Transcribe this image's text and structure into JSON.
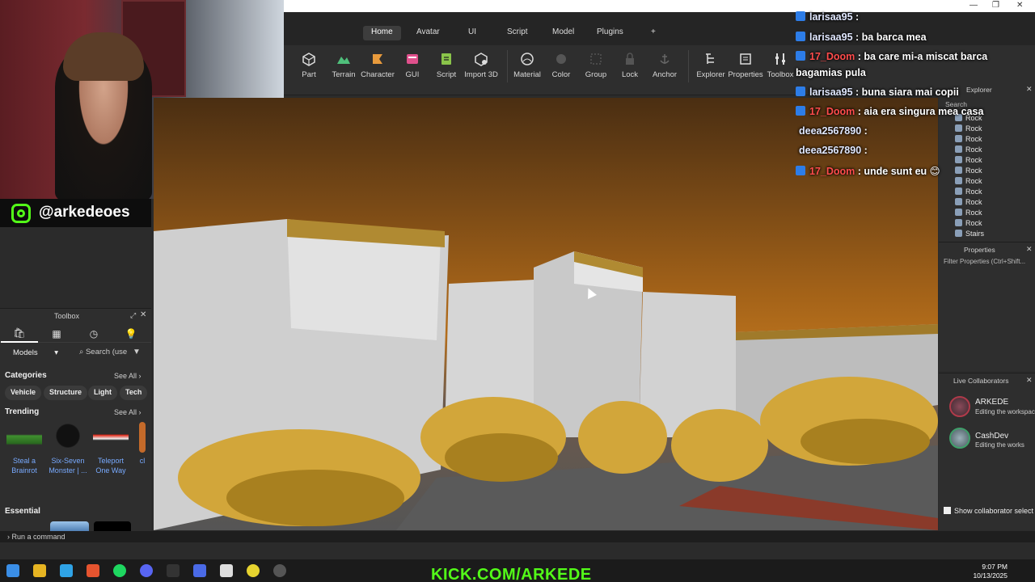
{
  "window": {
    "min": "—",
    "restore": "❐",
    "close": "✕"
  },
  "menu": {
    "tabs": [
      "Home",
      "Avatar",
      "UI",
      "Script",
      "Model",
      "Plugins"
    ],
    "add": "+"
  },
  "ribbon": {
    "tools": [
      "Part",
      "Terrain",
      "Character",
      "GUI",
      "Script",
      "Import 3D",
      "Material",
      "Color",
      "Group",
      "Lock",
      "Anchor",
      "Explorer",
      "Properties",
      "Toolbox"
    ]
  },
  "social": {
    "handle": "@arkedeoes"
  },
  "toolbox": {
    "title": "Toolbox",
    "models_label": "Models",
    "search_placeholder": "Search (use",
    "categories_title": "Categories",
    "see_all": "See All",
    "chips": [
      "Vehicle",
      "Structure",
      "Light",
      "Tech"
    ],
    "trending_title": "Trending",
    "assets": [
      {
        "name": "Steal a Brainrot"
      },
      {
        "name": "Six-Seven Monster | ..."
      },
      {
        "name": "Teleport One Way"
      },
      {
        "name": "cl"
      }
    ],
    "essential_title": "Essential"
  },
  "chat": [
    {
      "user": "larisaa95",
      "text": " : ",
      "color": "u1"
    },
    {
      "user": "larisaa95",
      "text": " : ba barca mea",
      "color": "u1"
    },
    {
      "user": "17_Doom",
      "text": " : ba care mi-a miscat barca",
      "cont": "bagamias pula",
      "color": "u2"
    },
    {
      "user": "larisaa95",
      "text": " : buna siara mai copii",
      "color": "u1"
    },
    {
      "user": "17_Doom",
      "text": " : aia era singura mea casa",
      "color": "u2"
    },
    {
      "user": "deea2567890",
      "text": " : ",
      "color": "u1",
      "nobadge": true
    },
    {
      "user": "deea2567890",
      "text": " : ",
      "color": "u1",
      "nobadge": true
    },
    {
      "user": "17_Doom",
      "text": " : unde sunt eu 😊",
      "color": "u2"
    }
  ],
  "explorer": {
    "title": "Explorer",
    "search_placeholder": "Search",
    "rows": [
      "Rock",
      "Rock",
      "Rock",
      "Rock",
      "Rock",
      "Rock",
      "Rock",
      "Rock",
      "Rock",
      "Rock",
      "Rock",
      "Stairs"
    ]
  },
  "properties": {
    "title": "Properties",
    "filter_placeholder": "Filter Properties (Ctrl+Shift..."
  },
  "collaborators": {
    "title": "Live Collaborators",
    "users": [
      {
        "name": "ARKEDE",
        "status": "Editing the workspace"
      },
      {
        "name": "CashDev",
        "status": "Editing the works"
      }
    ],
    "show_label": "Show collaborator select"
  },
  "command_bar": {
    "placeholder": "Run a command"
  },
  "overlay": {
    "kick": "KICK.COM/ARKEDE"
  },
  "clock": {
    "time": "9:07 PM",
    "date": "10/13/2025"
  }
}
